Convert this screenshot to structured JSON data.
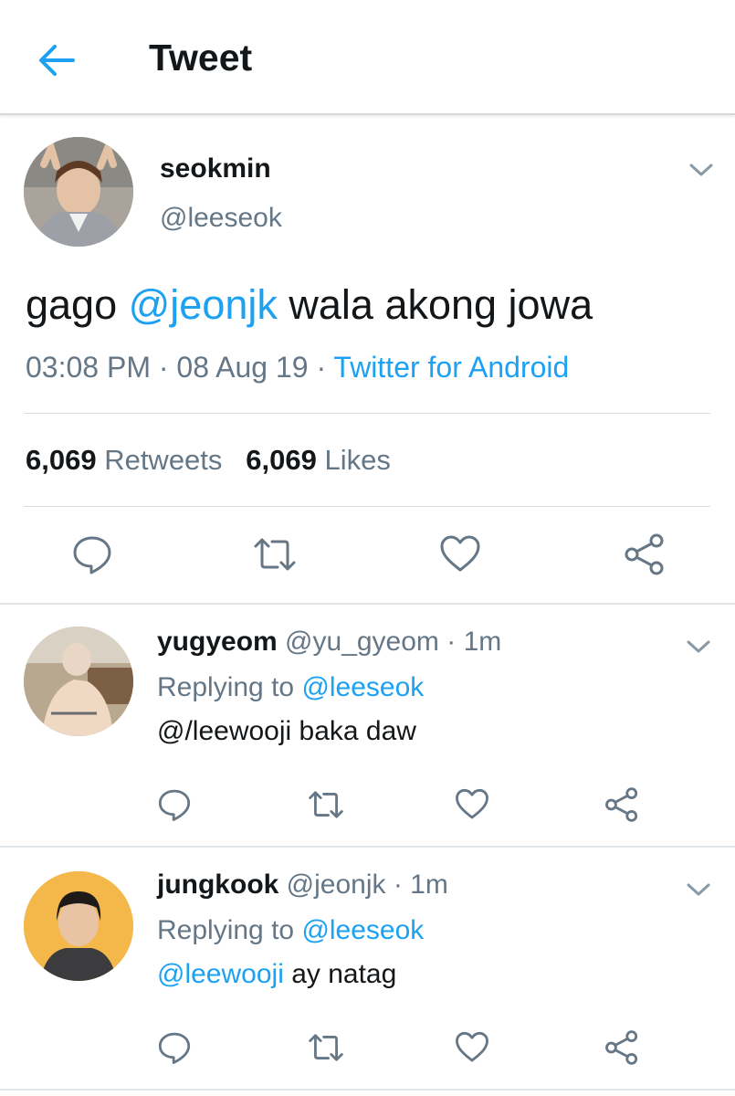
{
  "header": {
    "title": "Tweet",
    "back_icon": "arrow-left-icon"
  },
  "colors": {
    "accent": "#1da1f2",
    "secondary_text": "#657786",
    "primary_text": "#14171a",
    "divider": "#e1e6ea"
  },
  "main_tweet": {
    "name": "seokmin",
    "handle": "@leeseok",
    "text_before": "gago ",
    "mention": "@jeonjk",
    "text_after": " wala akong jowa",
    "time": "03:08 PM · 08 Aug 19 · ",
    "source": "Twitter for Android",
    "retweets_count": "6,069",
    "retweets_label": " Retweets",
    "likes_count": "6,069",
    "likes_label": " Likes"
  },
  "replies": [
    {
      "name": "yugyeom",
      "handle_time": " @yu_gyeom · 1m",
      "replying_prefix": "Replying to ",
      "replying_to": "@leeseok",
      "text_mention": "",
      "text": "@/leewooji baka daw"
    },
    {
      "name": "jungkook",
      "handle_time": " @jeonjk · 1m",
      "replying_prefix": "Replying to ",
      "replying_to": "@leeseok",
      "text_mention": "@leewooji",
      "text": " ay natag"
    }
  ],
  "icons": [
    "reply-icon",
    "retweet-icon",
    "like-icon",
    "share-icon",
    "chevron-down-icon"
  ]
}
